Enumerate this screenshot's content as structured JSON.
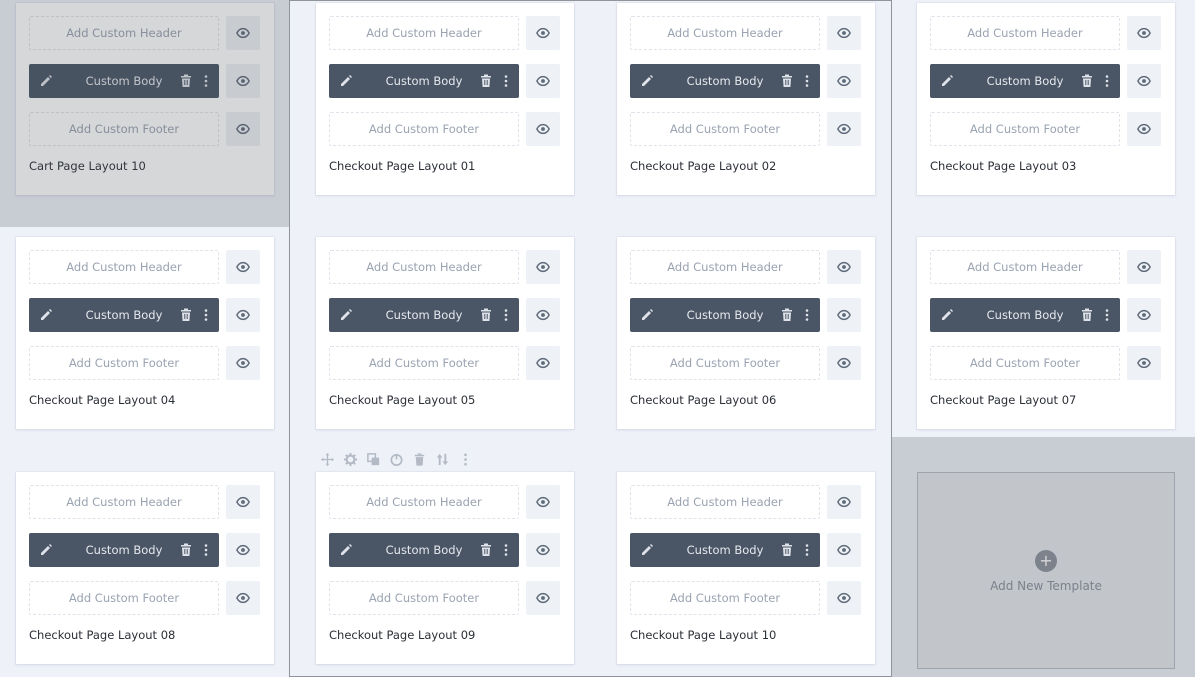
{
  "labels": {
    "add_header": "Add Custom Header",
    "custom_body": "Custom Body",
    "add_footer": "Add Custom Footer",
    "add_new_template": "Add New Template",
    "plus": "+"
  },
  "templates": [
    {
      "title": "Cart Page Layout 10"
    },
    {
      "title": "Checkout Page Layout 01"
    },
    {
      "title": "Checkout Page Layout 02"
    },
    {
      "title": "Checkout Page Layout 03"
    },
    {
      "title": "Checkout Page Layout 04"
    },
    {
      "title": "Checkout Page Layout 05"
    },
    {
      "title": "Checkout Page Layout 06"
    },
    {
      "title": "Checkout Page Layout 07"
    },
    {
      "title": "Checkout Page Layout 08"
    },
    {
      "title": "Checkout Page Layout 09"
    },
    {
      "title": "Checkout Page Layout 10"
    }
  ],
  "toolbar_icons": [
    "move-icon",
    "settings-icon",
    "duplicate-icon",
    "power-icon",
    "trash-icon",
    "sort-icon",
    "more-icon"
  ],
  "colors": {
    "body_bg": "#4a5666",
    "page_bg": "#eef1f8",
    "card_bg": "#ffffff",
    "icon": "#5f6b7a"
  }
}
